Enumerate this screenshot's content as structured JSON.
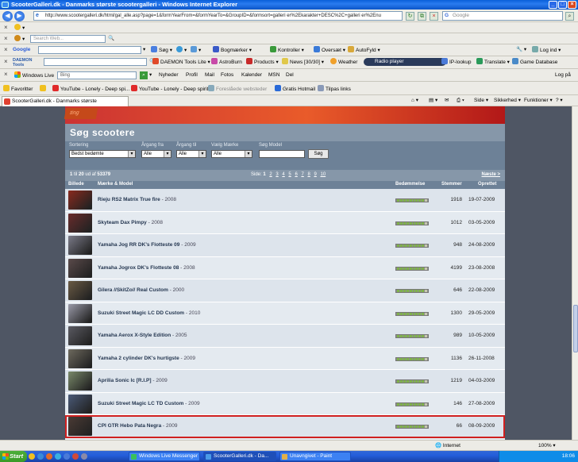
{
  "window": {
    "title": "ScooterGalleri.dk - Danmarks største scootergalleri - Windows Internet Explorer"
  },
  "address": {
    "url": "http://www.scootergalleri.dk/html/gal_alle.asp?page=1&formYearFrom=&formYearTo=&GroupID=&formsort=galleri er%2Ekarakter+DESC%2C+galleri er%2Enu",
    "search_placeholder": "Google"
  },
  "toolbar1": {
    "close": "×"
  },
  "toolbar2": {
    "search_placeholder": "Search Web..."
  },
  "toolbar3": {
    "items": [
      "Søg",
      "Bogmærker",
      "Kontroller",
      "Oversæt",
      "AutoFyld",
      "Log ind"
    ]
  },
  "toolbar4": {
    "items": [
      "DAEMON Tools Lite",
      "AstroBurn",
      "Products",
      "News [30/30]",
      "Weather",
      "Radio player",
      "IP-lookup",
      "Translate",
      "Game Database"
    ]
  },
  "toolbar5": {
    "brand": "Windows Live",
    "search_value": "Bing",
    "items": [
      "Nyheder",
      "Profil",
      "Mail",
      "Fotos",
      "Kalender",
      "MSN",
      "Del"
    ],
    "login": "Log på"
  },
  "favbar": {
    "favorites_label": "Favoritter",
    "links": [
      "YouTube - Lonely - Deep spi...",
      "YouTube - Lonely - Deep spirit",
      "Foreslåede websteder",
      "Gratis Hotmail",
      "Tilpas links"
    ]
  },
  "tabbar": {
    "tab_title": "ScooterGalleri.dk - Danmarks største scootergalleri",
    "commands": [
      "Side",
      "Sikkerhed",
      "Funktioner"
    ]
  },
  "page": {
    "banner_sub": "ting",
    "heading": "Søg scootere",
    "filters": {
      "sortering_label": "Sortering",
      "sortering_value": "Bedst bedømte",
      "aargang_fra_label": "Årgang fra",
      "aargang_fra_value": "Alle",
      "aargang_til_label": "Årgang til",
      "aargang_til_value": "Alle",
      "vaelg_maerke_label": "Vælg Mærke",
      "vaelg_maerke_value": "Alle",
      "soeg_model_label": "Søg Model",
      "search_button": "Søg"
    },
    "pager": {
      "range_from": "1",
      "til": "til",
      "range_to": "20",
      "ud_af": "ud af",
      "total": "53379",
      "side_label": "Side:",
      "pages": [
        "1",
        "2",
        "3",
        "4",
        "5",
        "6",
        "7",
        "8",
        "9",
        "10"
      ],
      "next": "Næste >"
    },
    "columns": {
      "image": "Billede",
      "make_model": "Mærke & Model",
      "rating": "Bedømmelse",
      "votes": "Stemmer",
      "created": "Oprettet"
    },
    "rows": [
      {
        "title": "Rieju RS2 Matrix True fire",
        "year": "- 2008",
        "votes": "1918",
        "date": "19-07-2009",
        "rating": 9,
        "thumb": "#8a2a1e"
      },
      {
        "title": "Skyteam Dax Pimpy",
        "year": "- 2008",
        "votes": "1012",
        "date": "03-05-2009",
        "rating": 9,
        "thumb": "#6a2c2c"
      },
      {
        "title": "Yamaha Jog RR DK's Flotteste 09",
        "year": "- 2009",
        "votes": "948",
        "date": "24-08-2009",
        "rating": 9,
        "thumb": "#7a7a88"
      },
      {
        "title": "Yamaha Jogrox DK's Flotteste 08",
        "year": "- 2008",
        "votes": "4199",
        "date": "23-08-2008",
        "rating": 9,
        "thumb": "#5a4a4a"
      },
      {
        "title": "Gilera //SkitZo// Real Custom",
        "year": "- 2000",
        "votes": "646",
        "date": "22-08-2009",
        "rating": 9,
        "thumb": "#6a5a44"
      },
      {
        "title": "Suzuki Street Magic LC DD Custom",
        "year": "- 2010",
        "votes": "1300",
        "date": "29-05-2009",
        "rating": 9,
        "thumb": "#9a9aa8"
      },
      {
        "title": "Yamaha Aerox X-Style Edition",
        "year": "- 2005",
        "votes": "989",
        "date": "10-05-2009",
        "rating": 9,
        "thumb": "#5a5a62"
      },
      {
        "title": "Yamaha 2 cylinder DK's hurtigste",
        "year": "- 2009",
        "votes": "1136",
        "date": "26-11-2008",
        "rating": 9,
        "thumb": "#6e6a5e"
      },
      {
        "title": "Aprilia Sonic lc [R.I.P]",
        "year": "- 2009",
        "votes": "1219",
        "date": "04-03-2009",
        "rating": 9,
        "thumb": "#7a8a6a"
      },
      {
        "title": "Suzuki Street Magic LC TD Custom",
        "year": "- 2009",
        "votes": "146",
        "date": "27-08-2009",
        "rating": 9,
        "thumb": "#4a5a78"
      },
      {
        "title": "CPI GTR Hebo Pata Negra",
        "year": "- 2009",
        "votes": "66",
        "date": "08-09-2009",
        "rating": 9,
        "thumb": "#4a3a34"
      }
    ]
  },
  "status": {
    "zone": "Internet",
    "zoom": "100%"
  },
  "taskbar": {
    "start": "Start",
    "buttons": [
      "Windows Live Messenger",
      "ScooterGalleri.dk - Da...",
      "Unavngivet - Paint"
    ],
    "clock": "18:06"
  }
}
